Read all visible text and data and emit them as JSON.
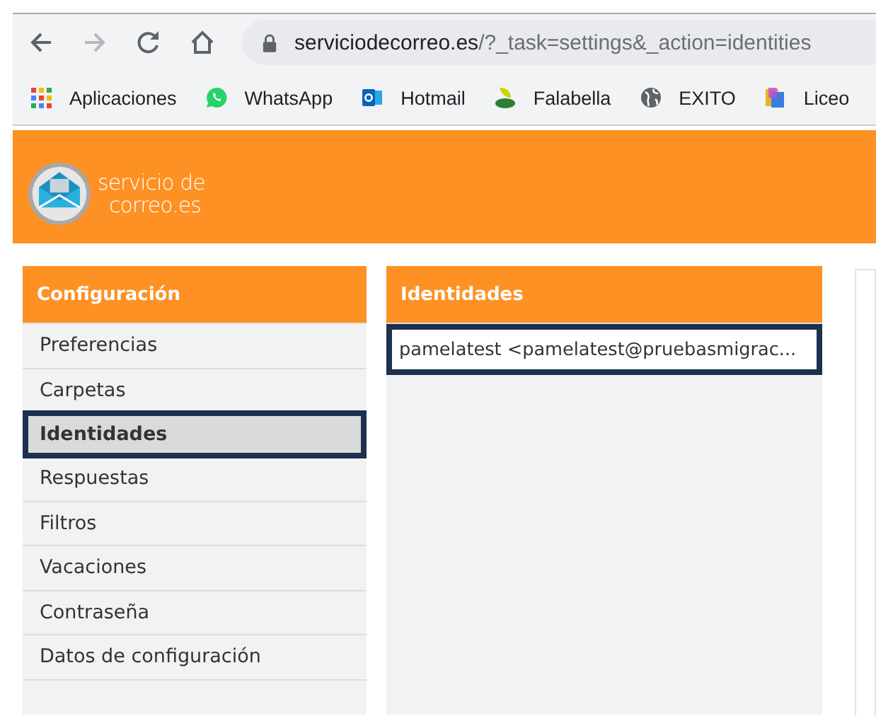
{
  "browser": {
    "url_host": "serviciodecorreo.es",
    "url_path": "/?_task=settings&_action=identities",
    "back_enabled": true,
    "forward_enabled": false
  },
  "bookmarks": [
    {
      "label": "Aplicaciones",
      "kind": "apps"
    },
    {
      "label": "WhatsApp",
      "kind": "chat"
    },
    {
      "label": "Hotmail",
      "kind": "mail"
    },
    {
      "label": "Falabella",
      "kind": "leaf"
    },
    {
      "label": "EXITO",
      "kind": "globe"
    },
    {
      "label": "Liceo",
      "kind": "book"
    }
  ],
  "header": {
    "logo_line1": "servicio de",
    "logo_line2": "correo.es"
  },
  "sidebar": {
    "title": "Configuración",
    "items": [
      {
        "label": "Preferencias",
        "selected": false
      },
      {
        "label": "Carpetas",
        "selected": false
      },
      {
        "label": "Identidades",
        "selected": true
      },
      {
        "label": "Respuestas",
        "selected": false
      },
      {
        "label": "Filtros",
        "selected": false
      },
      {
        "label": "Vacaciones",
        "selected": false
      },
      {
        "label": "Contraseña",
        "selected": false
      },
      {
        "label": "Datos de configuración",
        "selected": false
      }
    ]
  },
  "identities": {
    "title": "Identidades",
    "items": [
      {
        "label": "pamelatest <pamelatest@pruebasmigrac...",
        "selected": true
      }
    ]
  }
}
